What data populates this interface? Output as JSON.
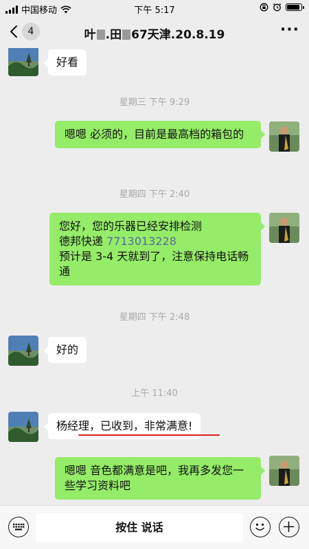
{
  "status_bar": {
    "carrier": "中国移动",
    "time": "下午 5:17"
  },
  "nav": {
    "unread_count": "4",
    "title_part1": "叶",
    "title_part2": ".田",
    "title_part3": "67天津.20.8.19",
    "more_label": "···"
  },
  "messages": [
    {
      "text": "好看"
    },
    {
      "text": "星期三 下午 9:29"
    },
    {
      "text": "嗯嗯  必须的，目前是最高档的箱包的"
    },
    {
      "text": "星期四 下午 2:40"
    },
    {
      "text_line1": "您好，您的乐器已经安排检测",
      "text_line2_prefix": "德邦快递 ",
      "phone": "7713013228",
      "text_line3": "预计是 3-4 天就到了，注意保持电话畅通"
    },
    {
      "text": "星期四 下午 2:48"
    },
    {
      "text": "好的"
    },
    {
      "text": "上午 11:40"
    },
    {
      "text": "杨经理，已收到，非常满意!"
    },
    {
      "text": "嗯嗯  音色都满意是吧，我再多发您一些学习资料吧"
    }
  ],
  "input_bar": {
    "voice_label": "按住 说话"
  },
  "colors": {
    "background": "#ededed",
    "bubble_self": "#95ec69",
    "bubble_other": "#ffffff",
    "link": "#576b95",
    "highlight_underline": "#d81e1e"
  }
}
